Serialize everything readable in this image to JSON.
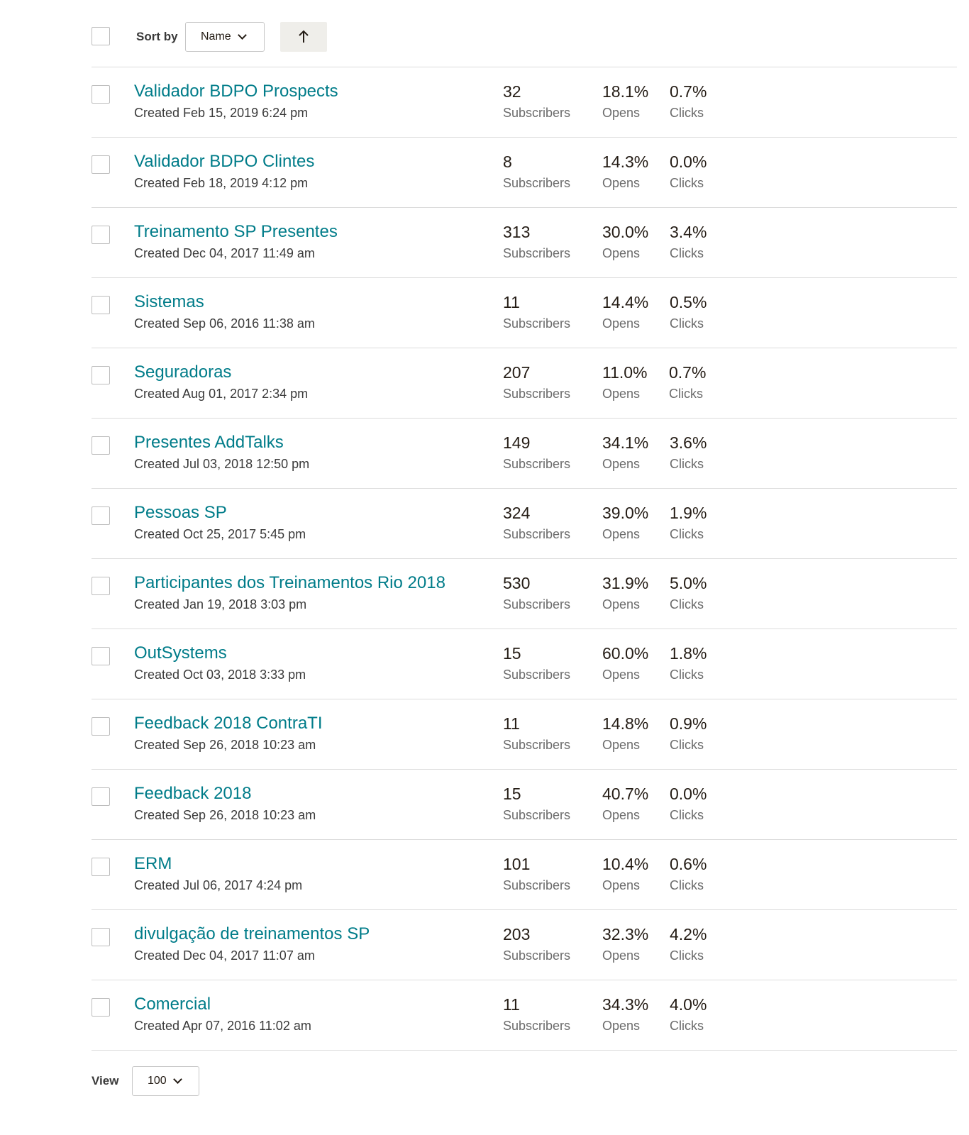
{
  "toolbar": {
    "sort_label": "Sort by",
    "sort_value": "Name",
    "sort_direction_icon": "arrow-up-icon"
  },
  "rows": [
    {
      "name": "Validador BDPO Prospects",
      "created": "Created Feb 15, 2019 6:24 pm",
      "subscribers": "32",
      "opens": "18.1%",
      "clicks": "0.7%"
    },
    {
      "name": "Validador BDPO Clintes",
      "created": "Created Feb 18, 2019 4:12 pm",
      "subscribers": "8",
      "opens": "14.3%",
      "clicks": "0.0%"
    },
    {
      "name": "Treinamento SP Presentes",
      "created": "Created Dec 04, 2017 11:49 am",
      "subscribers": "313",
      "opens": "30.0%",
      "clicks": "3.4%"
    },
    {
      "name": "Sistemas",
      "created": "Created Sep 06, 2016 11:38 am",
      "subscribers": "11",
      "opens": "14.4%",
      "clicks": "0.5%"
    },
    {
      "name": "Seguradoras",
      "created": "Created Aug 01, 2017 2:34 pm",
      "subscribers": "207",
      "opens": "11.0%",
      "clicks": "0.7%"
    },
    {
      "name": "Presentes AddTalks",
      "created": "Created Jul 03, 2018 12:50 pm",
      "subscribers": "149",
      "opens": "34.1%",
      "clicks": "3.6%"
    },
    {
      "name": "Pessoas SP",
      "created": "Created Oct 25, 2017 5:45 pm",
      "subscribers": "324",
      "opens": "39.0%",
      "clicks": "1.9%"
    },
    {
      "name": "Participantes dos Treinamentos Rio 2018",
      "created": "Created Jan 19, 2018 3:03 pm",
      "subscribers": "530",
      "opens": "31.9%",
      "clicks": "5.0%"
    },
    {
      "name": "OutSystems",
      "created": "Created Oct 03, 2018 3:33 pm",
      "subscribers": "15",
      "opens": "60.0%",
      "clicks": "1.8%"
    },
    {
      "name": "Feedback 2018 ContraTI",
      "created": "Created Sep 26, 2018 10:23 am",
      "subscribers": "11",
      "opens": "14.8%",
      "clicks": "0.9%"
    },
    {
      "name": "Feedback 2018",
      "created": "Created Sep 26, 2018 10:23 am",
      "subscribers": "15",
      "opens": "40.7%",
      "clicks": "0.0%"
    },
    {
      "name": "ERM",
      "created": "Created Jul 06, 2017 4:24 pm",
      "subscribers": "101",
      "opens": "10.4%",
      "clicks": "0.6%"
    },
    {
      "name": "divulgação de treinamentos SP",
      "created": "Created Dec 04, 2017 11:07 am",
      "subscribers": "203",
      "opens": "32.3%",
      "clicks": "4.2%"
    },
    {
      "name": "Comercial",
      "created": "Created Apr 07, 2016 11:02 am",
      "subscribers": "11",
      "opens": "34.3%",
      "clicks": "4.0%"
    }
  ],
  "labels": {
    "subscribers": "Subscribers",
    "opens": "Opens",
    "clicks": "Clicks"
  },
  "footer": {
    "view_label": "View",
    "view_value": "100"
  }
}
